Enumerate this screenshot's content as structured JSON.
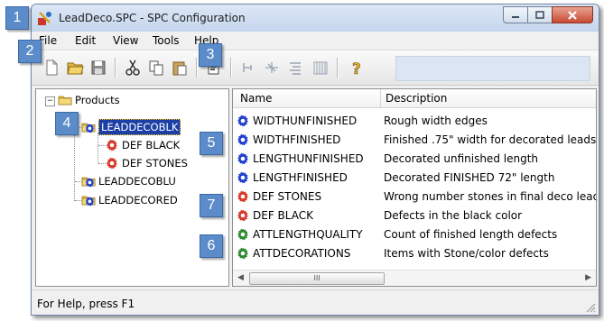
{
  "window": {
    "title": "LeadDeco.SPC - SPC Configuration",
    "caption_buttons": [
      "minimize-icon",
      "maximize-icon",
      "close-icon"
    ]
  },
  "menu": [
    "File",
    "Edit",
    "View",
    "Tools",
    "Help"
  ],
  "toolbar": {
    "buttons": [
      "new-document-icon",
      "open-folder-icon",
      "save-icon",
      "cut-icon",
      "copy-icon",
      "paste-icon",
      "properties-icon",
      "tool-a-icon",
      "tool-b-icon",
      "tool-c-icon",
      "tool-d-icon",
      "help-icon"
    ]
  },
  "tree": {
    "root": "Products",
    "nodes": [
      {
        "label": "LEADDECOBLK",
        "selected": true,
        "children": [
          "DEF BLACK",
          "DEF STONES"
        ]
      },
      {
        "label": "LEADDECOBLU"
      },
      {
        "label": "LEADDECORED"
      }
    ]
  },
  "list": {
    "columns": [
      "Name",
      "Description"
    ],
    "rows": [
      {
        "name": "WIDTHUNFINISHED",
        "description": "Rough width edges",
        "icon": "blue-gear-icon"
      },
      {
        "name": "WIDTHFINISHED",
        "description": "Finished .75\" width for decorated leads",
        "icon": "blue-gear-icon"
      },
      {
        "name": "LENGTHUNFINISHED",
        "description": "Decorated unfinished length",
        "icon": "blue-gear-icon"
      },
      {
        "name": "LENGTHFINISHED",
        "description": "Decorated FINISHED 72\" length",
        "icon": "blue-gear-icon"
      },
      {
        "name": "DEF STONES",
        "description": "Wrong number stones in final deco lead",
        "icon": "red-gear-icon"
      },
      {
        "name": "DEF BLACK",
        "description": "Defects in the black color",
        "icon": "red-gear-icon"
      },
      {
        "name": "ATTLENGTHQUALITY",
        "description": "Count of finished length defects",
        "icon": "green-gear-icon"
      },
      {
        "name": "ATTDECORATIONS",
        "description": "Items with Stone/color defects",
        "icon": "green-gear-icon"
      }
    ],
    "scroll_thumb": "III"
  },
  "status": {
    "text": "For Help, press F1"
  },
  "callouts": [
    "1",
    "2",
    "3",
    "4",
    "5",
    "6",
    "7"
  ],
  "colors": {
    "callout": "#5b8cc9",
    "selection": "#1c3fa6",
    "blue_gear": "#1f3fcf",
    "red_gear": "#d63a2a",
    "green_gear": "#2f8a2f"
  }
}
